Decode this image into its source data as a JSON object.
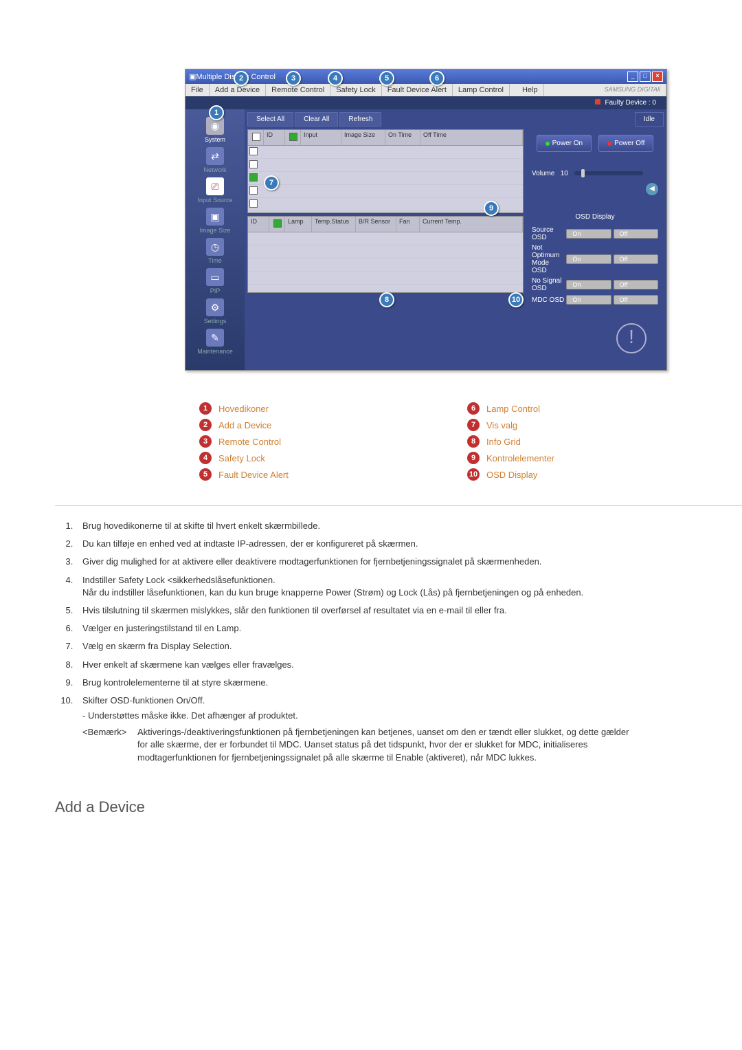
{
  "window": {
    "title": "Multiple Display Control",
    "menu": {
      "file": "File",
      "add": "Add a Device",
      "remote": "Remote Control",
      "safety": "Safety Lock",
      "fault": "Fault Device Alert",
      "lamp": "Lamp Control",
      "help": "Help"
    },
    "brand": "SAMSUNG DIGITAll",
    "faulty": "Faulty Device : 0"
  },
  "sidebar": {
    "system": "System",
    "network": "Network",
    "input": "Input Source",
    "imgsize": "Image Size",
    "time": "Time",
    "pip": "PIP",
    "settings": "Settings",
    "maint": "Maintenance"
  },
  "toolbar": {
    "select": "Select All",
    "clear": "Clear All",
    "refresh": "Refresh",
    "idle": "Idle"
  },
  "grid1": {
    "h1": "ID",
    "h2": "Input",
    "h3": "Image Size",
    "h4": "On Time",
    "h5": "Off Time"
  },
  "grid2": {
    "h1": "ID",
    "h2": "Lamp",
    "h3": "Temp.Status",
    "h4": "B/R Sensor",
    "h5": "Fan",
    "h6": "Current Temp."
  },
  "power": {
    "on": "Power On",
    "off": "Power Off"
  },
  "volume": {
    "label": "Volume",
    "value": "10"
  },
  "osd": {
    "title": "OSD Display",
    "rows": [
      {
        "label": "Source OSD"
      },
      {
        "label": "Not Optimum Mode OSD"
      },
      {
        "label": "No Signal OSD"
      },
      {
        "label": "MDC OSD"
      }
    ],
    "on": "On",
    "off": "Off"
  },
  "callouts": {
    "c1": "1",
    "c2": "2",
    "c3": "3",
    "c4": "4",
    "c5": "5",
    "c6": "6",
    "c7": "7",
    "c8": "8",
    "c9": "9",
    "c10": "10"
  },
  "legend": {
    "left": [
      {
        "n": "1",
        "t": "Hovedikoner"
      },
      {
        "n": "2",
        "t": "Add a Device"
      },
      {
        "n": "3",
        "t": "Remote Control"
      },
      {
        "n": "4",
        "t": "Safety Lock"
      },
      {
        "n": "5",
        "t": "Fault Device Alert"
      }
    ],
    "right": [
      {
        "n": "6",
        "t": "Lamp Control"
      },
      {
        "n": "7",
        "t": "Vis valg"
      },
      {
        "n": "8",
        "t": "Info Grid"
      },
      {
        "n": "9",
        "t": "Kontrolelementer"
      },
      {
        "n": "10",
        "t": "OSD Display"
      }
    ]
  },
  "descriptions": [
    "Brug hovedikonerne til at skifte til hvert enkelt skærmbillede.",
    "Du kan tilføje en enhed ved at indtaste IP-adressen, der er konfigureret på skærmen.",
    "Giver dig mulighed for at aktivere eller deaktivere modtagerfunktionen for fjernbetjeningssignalet på skærmenheden.",
    "Indstiller Safety Lock <sikkerhedslåsefunktionen.\nNår du indstiller låsefunktionen, kan du kun bruge knapperne Power (Strøm) og Lock (Lås) på fjernbetjeningen og på enheden.",
    "Hvis tilslutning til skærmen mislykkes, slår den funktionen til overførsel af resultatet via en e-mail til eller fra.",
    "Vælger en justeringstilstand til en Lamp.",
    "Vælg en skærm fra Display Selection.",
    "Hver enkelt af skærmene kan vælges eller fravælges.",
    "Brug kontrolelementerne til at styre skærmene.",
    "Skifter OSD-funktionen On/Off."
  ],
  "sub10": "- Understøttes måske ikke. Det afhænger af produktet.",
  "note": {
    "label": "<Bemærk>",
    "text": "Aktiverings-/deaktiveringsfunktionen på fjernbetjeningen kan betjenes, uanset om den er tændt eller slukket, og dette gælder for alle skærme, der er forbundet til MDC. Uanset status på det tidspunkt, hvor der er slukket for MDC, initialiseres modtagerfunktionen for fjernbetjeningssignalet på alle skærme til Enable (aktiveret), når MDC lukkes."
  },
  "heading": "Add a Device"
}
